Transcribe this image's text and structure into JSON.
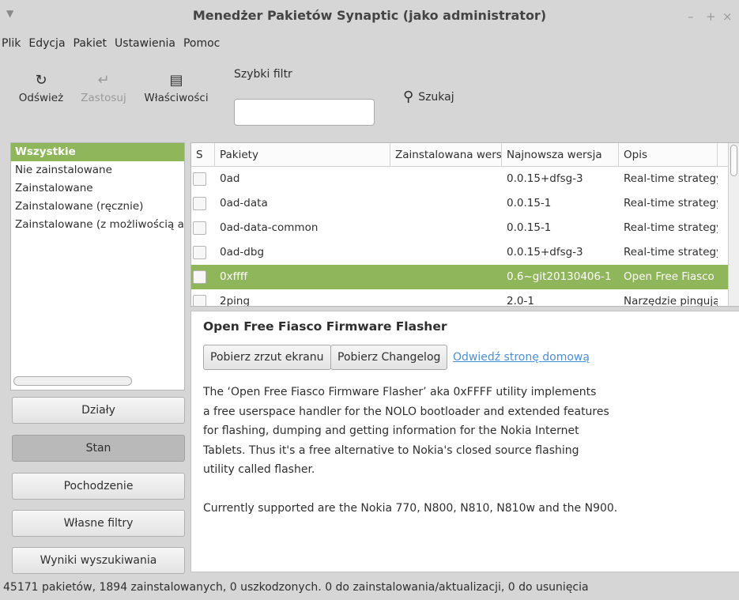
{
  "window": {
    "title": "Menedżer Pakietów Synaptic  (jako administrator)",
    "controls": {
      "minimize": "–",
      "maximize": "+",
      "close": "×"
    }
  },
  "menubar": [
    "Plik",
    "Edycja",
    "Pakiet",
    "Ustawienia",
    "Pomoc"
  ],
  "toolbar": {
    "refresh_label": "Odśwież",
    "apply_label": "Zastosuj",
    "properties_label": "Właściwości",
    "quick_filter_label": "Szybki filtr",
    "quick_filter_value": "",
    "search_label": "Szukaj"
  },
  "filters": {
    "items": [
      "Wszystkie",
      "Nie zainstalowane",
      "Zainstalowane",
      "Zainstalowane (ręcznie)",
      "Zainstalowane (z możliwością ak"
    ],
    "selected_index": 0
  },
  "side_buttons": [
    "Działy",
    "Stan",
    "Pochodzenie",
    "Własne filtry",
    "Wyniki wyszukiwania"
  ],
  "active_side_button": "Stan",
  "table": {
    "columns": [
      "S",
      "Pakiety",
      "Zainstalowana wers",
      "Najnowsza wersja",
      "Opis"
    ],
    "rows": [
      {
        "name": "0ad",
        "installed": "",
        "latest": "0.0.15+dfsg-3",
        "desc": "Real-time strategy"
      },
      {
        "name": "0ad-data",
        "installed": "",
        "latest": "0.0.15-1",
        "desc": "Real-time strategy"
      },
      {
        "name": "0ad-data-common",
        "installed": "",
        "latest": "0.0.15-1",
        "desc": "Real-time strategy"
      },
      {
        "name": "0ad-dbg",
        "installed": "",
        "latest": "0.0.15+dfsg-3",
        "desc": "Real-time strategy"
      },
      {
        "name": "0xffff",
        "installed": "",
        "latest": "0.6~git20130406-1",
        "desc": "Open Free Fiasco F"
      },
      {
        "name": "2ping",
        "installed": "",
        "latest": "2.0-1",
        "desc": "Narzędzie pingują"
      }
    ],
    "selected_index": 4
  },
  "details": {
    "title": "Open Free Fiasco Firmware Flasher",
    "screenshot_button": "Pobierz zrzut ekranu",
    "changelog_button": "Pobierz Changelog",
    "homepage_link": "Odwiedź stronę domową",
    "description": "The ‘Open Free Fiasco Firmware Flasher’ aka 0xFFFF utility implements\na free userspace handler for the NOLO bootloader and extended features\nfor flashing, dumping and getting information for the Nokia Internet\nTablets. Thus it's a free alternative to Nokia's closed source flashing\nutility called flasher.\n\nCurrently supported are the Nokia 770, N800, N810, N810w and the N900."
  },
  "status": "45171 pakietów, 1894 zainstalowanych, 0 uszkodzonych. 0 do zainstalowania/aktualizacji, 0 do usunięcia"
}
